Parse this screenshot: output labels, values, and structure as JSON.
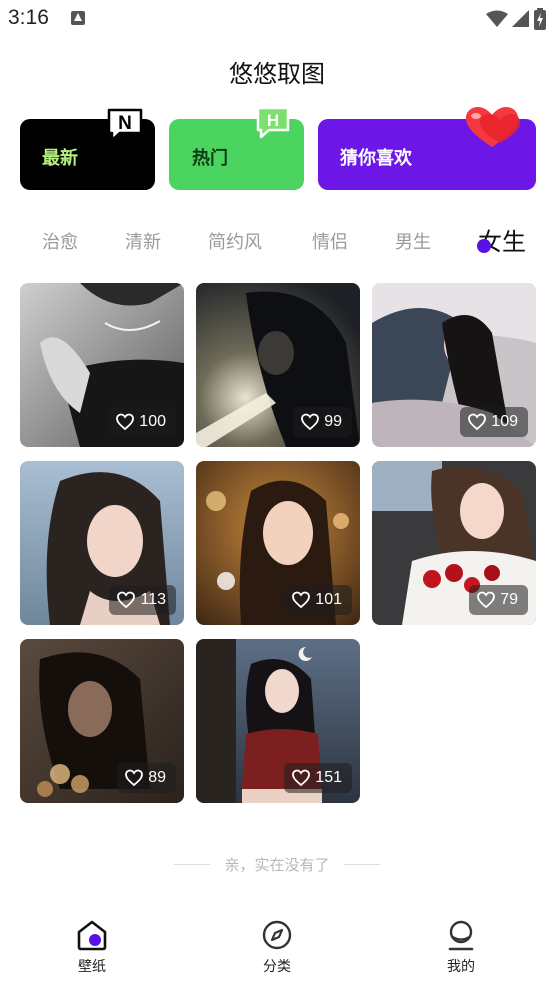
{
  "status_bar": {
    "time": "3:16"
  },
  "header": {
    "title": "悠悠取图"
  },
  "categories": [
    {
      "label": "最新",
      "badge": "N"
    },
    {
      "label": "热门",
      "badge": "H"
    },
    {
      "label": "猜你喜欢",
      "badge": "heart"
    }
  ],
  "tabs": [
    "治愈",
    "清新",
    "简约风",
    "情侣",
    "男生",
    "女生"
  ],
  "active_tab": "女生",
  "photos": [
    {
      "likes": "100"
    },
    {
      "likes": "99"
    },
    {
      "likes": "109"
    },
    {
      "likes": "113"
    },
    {
      "likes": "101"
    },
    {
      "likes": "79"
    },
    {
      "likes": "89"
    },
    {
      "likes": "151"
    }
  ],
  "end_note": "亲，实在没有了",
  "bottom_nav": [
    {
      "label": "壁纸",
      "icon": "home-icon",
      "active": true
    },
    {
      "label": "分类",
      "icon": "compass-icon",
      "active": false
    },
    {
      "label": "我的",
      "icon": "profile-icon",
      "active": false
    }
  ],
  "colors": {
    "accent": "#5a10e6",
    "latest_card": "#000000",
    "hot_card": "#4cd461",
    "guess_card": "#6d16e8"
  }
}
